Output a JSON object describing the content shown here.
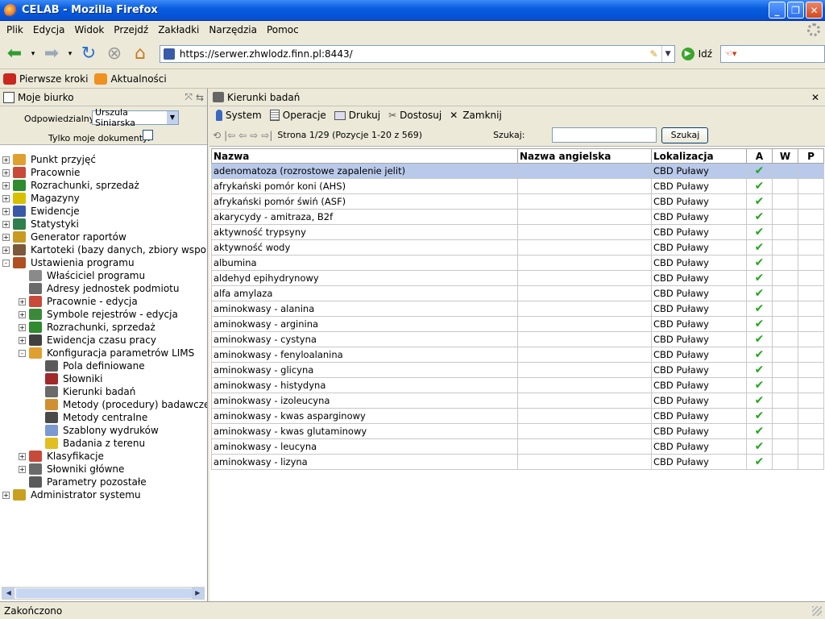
{
  "window": {
    "title": "CELAB - Mozilla Firefox"
  },
  "menu": [
    "Plik",
    "Edycja",
    "Widok",
    "Przejdź",
    "Zakładki",
    "Narzędzia",
    "Pomoc"
  ],
  "nav": {
    "url": "https://serwer.zhwlodz.finn.pl:8443/",
    "go_label": "Idź"
  },
  "bookmarks": [
    "Pierwsze kroki",
    "Aktualności"
  ],
  "left_panel": {
    "title": "Moje biurko",
    "responsible_label": "Odpowiedzialny:",
    "responsible_value": "Urszula Siniarska",
    "only_mine_label": "Tylko moje dokumenty:"
  },
  "tree": [
    {
      "label": "Punkt przyjęć",
      "level": 0,
      "exp": "+",
      "icon": "flask-icon",
      "color": "#e0a030"
    },
    {
      "label": "Pracownie",
      "level": 0,
      "exp": "+",
      "icon": "lab-icon",
      "color": "#c84a3a"
    },
    {
      "label": "Rozrachunki, sprzedaż",
      "level": 0,
      "exp": "+",
      "icon": "money-icon",
      "color": "#2e8b2e"
    },
    {
      "label": "Magazyny",
      "level": 0,
      "exp": "+",
      "icon": "warehouse-icon",
      "color": "#d8c000"
    },
    {
      "label": "Ewidencje",
      "level": 0,
      "exp": "+",
      "icon": "register-icon",
      "color": "#3a58a8"
    },
    {
      "label": "Statystyki",
      "level": 0,
      "exp": "+",
      "icon": "statistics-icon",
      "color": "#2f7f4f"
    },
    {
      "label": "Generator raportów",
      "level": 0,
      "exp": "+",
      "icon": "report-generator-icon",
      "color": "#c89a20"
    },
    {
      "label": "Kartoteki (bazy danych, zbiory wspoma",
      "level": 0,
      "exp": "+",
      "icon": "card-index-icon",
      "color": "#7a5a3a"
    },
    {
      "label": "Ustawienia programu",
      "level": 0,
      "exp": "-",
      "icon": "tools-icon",
      "color": "#b05020"
    },
    {
      "label": "Właściciel programu",
      "level": 1,
      "exp": "",
      "icon": "owner-icon",
      "color": "#8a8a8a"
    },
    {
      "label": "Adresy jednostek podmiotu",
      "level": 1,
      "exp": "",
      "icon": "address-icon",
      "color": "#6a6a6a"
    },
    {
      "label": "Pracownie - edycja",
      "level": 1,
      "exp": "+",
      "icon": "lab-edit-icon",
      "color": "#c84a3a"
    },
    {
      "label": "Symbole rejestrów - edycja",
      "level": 1,
      "exp": "+",
      "icon": "register-symbol-icon",
      "color": "#3a8a3a"
    },
    {
      "label": "Rozrachunki, sprzedaż",
      "level": 1,
      "exp": "+",
      "icon": "money-icon",
      "color": "#2e8b2e"
    },
    {
      "label": "Ewidencja czasu pracy",
      "level": 1,
      "exp": "+",
      "icon": "worktime-icon",
      "color": "#404040"
    },
    {
      "label": "Konfiguracja parametrów LIMS",
      "level": 1,
      "exp": "-",
      "icon": "flask-config-icon",
      "color": "#e0a030"
    },
    {
      "label": "Pola definiowane",
      "level": 2,
      "exp": "",
      "icon": "defined-fields-icon",
      "color": "#5a5a5a"
    },
    {
      "label": "Słowniki",
      "level": 2,
      "exp": "",
      "icon": "dictionary-icon",
      "color": "#a02a2a"
    },
    {
      "label": "Kierunki badań",
      "level": 2,
      "exp": "",
      "icon": "research-directions-icon",
      "color": "#6a6a6a"
    },
    {
      "label": "Metody (procedury) badawcze",
      "level": 2,
      "exp": "",
      "icon": "research-methods-icon",
      "color": "#d09030"
    },
    {
      "label": "Metody centralne",
      "level": 2,
      "exp": "",
      "icon": "central-methods-icon",
      "color": "#4a4a4a"
    },
    {
      "label": "Szablony wydruków",
      "level": 2,
      "exp": "",
      "icon": "print-template-icon",
      "color": "#7a9ad0"
    },
    {
      "label": "Badania z terenu",
      "level": 2,
      "exp": "",
      "icon": "field-research-icon",
      "color": "#e0c020"
    },
    {
      "label": "Klasyfikacje",
      "level": 1,
      "exp": "+",
      "icon": "classification-icon",
      "color": "#c84a3a"
    },
    {
      "label": "Słowniki główne",
      "level": 1,
      "exp": "+",
      "icon": "main-dictionary-icon",
      "color": "#6a6a6a"
    },
    {
      "label": "Parametry pozostałe",
      "level": 1,
      "exp": "",
      "icon": "other-params-icon",
      "color": "#5a5a5a"
    },
    {
      "label": "Administrator systemu",
      "level": 0,
      "exp": "+",
      "icon": "admin-key-icon",
      "color": "#c8a020"
    }
  ],
  "right_panel": {
    "title": "Kierunki badań",
    "toolbar": [
      {
        "label": "System",
        "icon": "system-icon"
      },
      {
        "label": "Operacje",
        "icon": "operations-icon"
      },
      {
        "label": "Drukuj",
        "icon": "print-icon"
      },
      {
        "label": "Dostosuj",
        "icon": "customize-icon"
      },
      {
        "label": "Zamknij",
        "icon": "close-icon"
      }
    ],
    "pager_info": "Strona 1/29 (Pozycje 1-20 z 569)",
    "search_label": "Szukaj:",
    "search_button": "Szukaj"
  },
  "table": {
    "columns": [
      "Nazwa",
      "Nazwa angielska",
      "Lokalizacja",
      "A",
      "W",
      "P"
    ],
    "rows": [
      {
        "name": "adenomatoza (rozrostowe zapalenie jelit)",
        "english": "",
        "location": "CBD Puławy",
        "a": "✔",
        "w": "",
        "p": ""
      },
      {
        "name": "afrykański pomór koni (AHS)",
        "english": "",
        "location": "CBD Puławy",
        "a": "✔",
        "w": "",
        "p": ""
      },
      {
        "name": "afrykański pomór świń (ASF)",
        "english": "",
        "location": "CBD Puławy",
        "a": "✔",
        "w": "",
        "p": ""
      },
      {
        "name": "akarycydy - amitraza, B2f",
        "english": "",
        "location": "CBD Puławy",
        "a": "✔",
        "w": "",
        "p": ""
      },
      {
        "name": "aktywność trypsyny",
        "english": "",
        "location": "CBD Puławy",
        "a": "✔",
        "w": "",
        "p": ""
      },
      {
        "name": "aktywność wody",
        "english": "",
        "location": "CBD Puławy",
        "a": "✔",
        "w": "",
        "p": ""
      },
      {
        "name": "albumina",
        "english": "",
        "location": "CBD Puławy",
        "a": "✔",
        "w": "",
        "p": ""
      },
      {
        "name": "aldehyd epihydrynowy",
        "english": "",
        "location": "CBD Puławy",
        "a": "✔",
        "w": "",
        "p": ""
      },
      {
        "name": "alfa amylaza",
        "english": "",
        "location": "CBD Puławy",
        "a": "✔",
        "w": "",
        "p": ""
      },
      {
        "name": "aminokwasy - alanina",
        "english": "",
        "location": "CBD Puławy",
        "a": "✔",
        "w": "",
        "p": ""
      },
      {
        "name": "aminokwasy - arginina",
        "english": "",
        "location": "CBD Puławy",
        "a": "✔",
        "w": "",
        "p": ""
      },
      {
        "name": "aminokwasy - cystyna",
        "english": "",
        "location": "CBD Puławy",
        "a": "✔",
        "w": "",
        "p": ""
      },
      {
        "name": "aminokwasy - fenyloalanina",
        "english": "",
        "location": "CBD Puławy",
        "a": "✔",
        "w": "",
        "p": ""
      },
      {
        "name": "aminokwasy - glicyna",
        "english": "",
        "location": "CBD Puławy",
        "a": "✔",
        "w": "",
        "p": ""
      },
      {
        "name": "aminokwasy - histydyna",
        "english": "",
        "location": "CBD Puławy",
        "a": "✔",
        "w": "",
        "p": ""
      },
      {
        "name": "aminokwasy - izoleucyna",
        "english": "",
        "location": "CBD Puławy",
        "a": "✔",
        "w": "",
        "p": ""
      },
      {
        "name": "aminokwasy - kwas asparginowy",
        "english": "",
        "location": "CBD Puławy",
        "a": "✔",
        "w": "",
        "p": ""
      },
      {
        "name": "aminokwasy - kwas glutaminowy",
        "english": "",
        "location": "CBD Puławy",
        "a": "✔",
        "w": "",
        "p": ""
      },
      {
        "name": "aminokwasy - leucyna",
        "english": "",
        "location": "CBD Puławy",
        "a": "✔",
        "w": "",
        "p": ""
      },
      {
        "name": "aminokwasy - lizyna",
        "english": "",
        "location": "CBD Puławy",
        "a": "✔",
        "w": "",
        "p": ""
      }
    ]
  },
  "status": {
    "text": "Zakończono"
  }
}
